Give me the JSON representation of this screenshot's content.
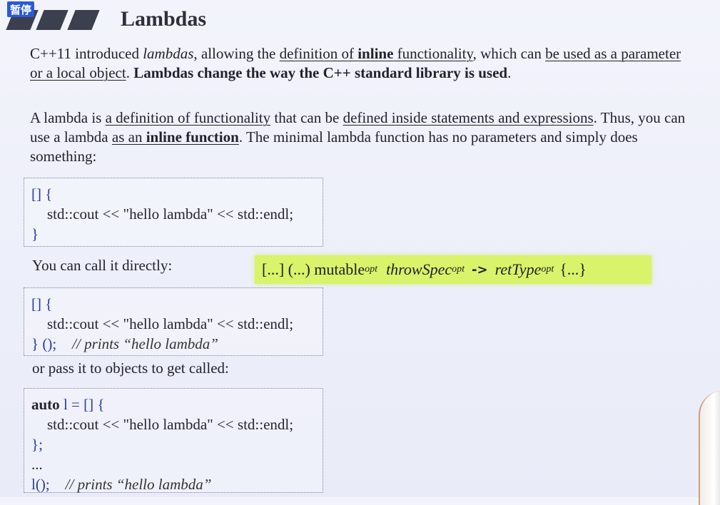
{
  "overlay": {
    "badge": "暂停"
  },
  "title": "Lambdas",
  "para1": {
    "a": "C++11 introduced ",
    "b": "lambdas",
    "c": ", allowing the ",
    "d": "definition of ",
    "e": "inline",
    "f": " functionality",
    "g": ", which can ",
    "h": "be used as a parameter or a local object",
    "i": ". ",
    "j": "Lambdas change the way the C++ standard library is used",
    "k": "."
  },
  "para2": {
    "a": "A lambda is ",
    "b": "a definition of functionality",
    "c": " that can be ",
    "d": "defined inside statements and expressions",
    "e": ". Thus, you can use a lambda ",
    "f": "as an ",
    "g": "inline function",
    "h": ". The minimal lambda function has no parameters and simply does something:"
  },
  "code1": {
    "l1": "[] {",
    "l2": "std::cout << \"hello lambda\" << std::endl;",
    "l3": "}"
  },
  "label1": "You can call it directly:",
  "syntax": {
    "a": "[...] (...) mutable",
    "a_sub": "opt",
    "b": "throwSpec",
    "b_sub": "opt",
    "arrow": "->",
    "c": "retType",
    "c_sub": "opt",
    "d": "{...}"
  },
  "code2": {
    "l1": "[] {",
    "l2": "std::cout << \"hello lambda\" << std::endl;",
    "l3a": "} ();",
    "l3b": "// prints “hello lambda”"
  },
  "label2": "or pass it to objects to get called:",
  "code3": {
    "l1a": "auto",
    "l1b": " l = [] {",
    "l2": "std::cout << \"hello lambda\" << std::endl;",
    "l3": "};",
    "l4": "...",
    "l5a": "l();",
    "l5b": "// prints “hello lambda”"
  }
}
